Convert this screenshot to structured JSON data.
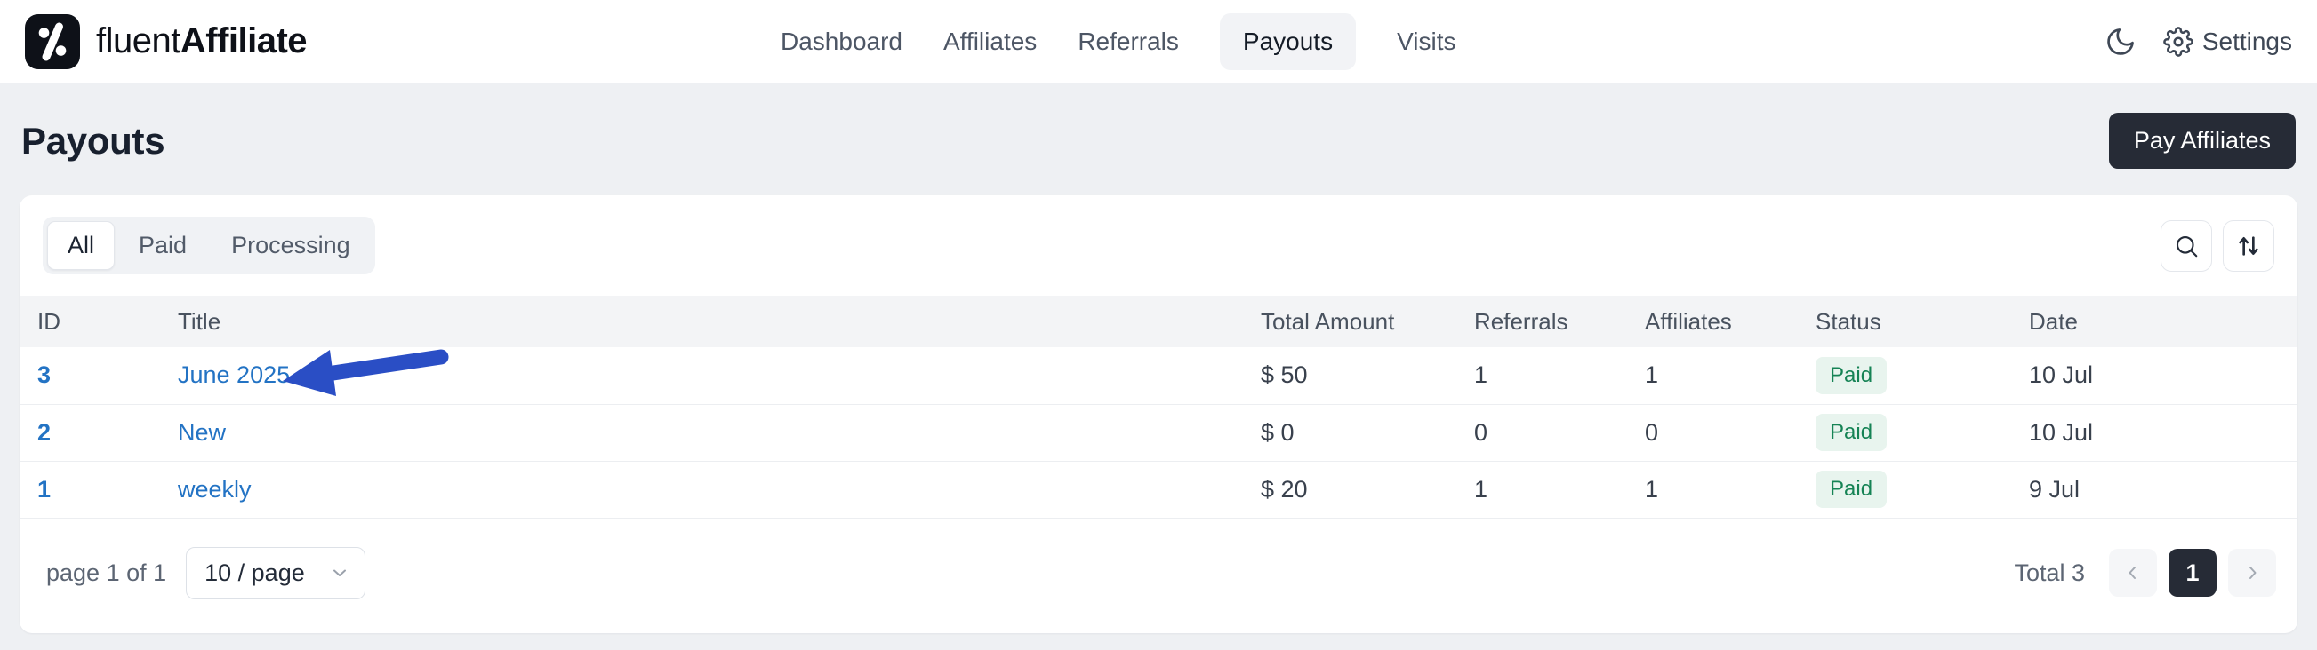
{
  "brand": {
    "name_light": "fluent",
    "name_bold": "Affiliate"
  },
  "nav": {
    "items": [
      {
        "label": "Dashboard",
        "active": false
      },
      {
        "label": "Affiliates",
        "active": false
      },
      {
        "label": "Referrals",
        "active": false
      },
      {
        "label": "Payouts",
        "active": true
      },
      {
        "label": "Visits",
        "active": false
      }
    ]
  },
  "topbar": {
    "settings_label": "Settings"
  },
  "page": {
    "title": "Payouts",
    "pay_button_label": "Pay Affiliates"
  },
  "filters": {
    "tabs": [
      {
        "label": "All",
        "active": true
      },
      {
        "label": "Paid",
        "active": false
      },
      {
        "label": "Processing",
        "active": false
      }
    ]
  },
  "table": {
    "columns": [
      "ID",
      "Title",
      "Total Amount",
      "Referrals",
      "Affiliates",
      "Status",
      "Date"
    ],
    "rows": [
      {
        "id": "3",
        "title": "June 2025",
        "amount": "$ 50",
        "referrals": "1",
        "affiliates": "1",
        "status": "Paid",
        "date": "10 Jul"
      },
      {
        "id": "2",
        "title": "New",
        "amount": "$ 0",
        "referrals": "0",
        "affiliates": "0",
        "status": "Paid",
        "date": "10 Jul"
      },
      {
        "id": "1",
        "title": "weekly",
        "amount": "$ 20",
        "referrals": "1",
        "affiliates": "1",
        "status": "Paid",
        "date": "9 Jul"
      }
    ]
  },
  "pagination": {
    "page_info": "page 1 of 1",
    "page_size": "10 / page",
    "total_label": "Total 3",
    "current_page": "1"
  },
  "colors": {
    "accent_blue": "#2373c4",
    "badge_green_text": "#168355",
    "badge_green_bg": "#e8f4ee",
    "dark_button": "#262b36",
    "annotation_arrow_blue": "#2a4ec5",
    "page_background": "#eef0f3"
  }
}
